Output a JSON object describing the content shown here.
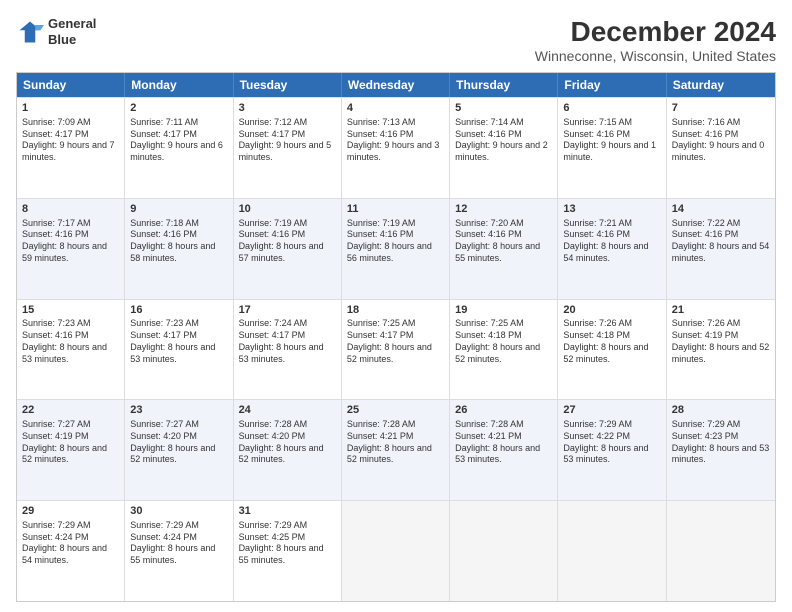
{
  "header": {
    "logo_line1": "General",
    "logo_line2": "Blue",
    "title": "December 2024",
    "subtitle": "Winneconne, Wisconsin, United States"
  },
  "days": [
    "Sunday",
    "Monday",
    "Tuesday",
    "Wednesday",
    "Thursday",
    "Friday",
    "Saturday"
  ],
  "rows": [
    [
      {
        "day": "1",
        "text": "Sunrise: 7:09 AM\nSunset: 4:17 PM\nDaylight: 9 hours and 7 minutes."
      },
      {
        "day": "2",
        "text": "Sunrise: 7:11 AM\nSunset: 4:17 PM\nDaylight: 9 hours and 6 minutes."
      },
      {
        "day": "3",
        "text": "Sunrise: 7:12 AM\nSunset: 4:17 PM\nDaylight: 9 hours and 5 minutes."
      },
      {
        "day": "4",
        "text": "Sunrise: 7:13 AM\nSunset: 4:16 PM\nDaylight: 9 hours and 3 minutes."
      },
      {
        "day": "5",
        "text": "Sunrise: 7:14 AM\nSunset: 4:16 PM\nDaylight: 9 hours and 2 minutes."
      },
      {
        "day": "6",
        "text": "Sunrise: 7:15 AM\nSunset: 4:16 PM\nDaylight: 9 hours and 1 minute."
      },
      {
        "day": "7",
        "text": "Sunrise: 7:16 AM\nSunset: 4:16 PM\nDaylight: 9 hours and 0 minutes."
      }
    ],
    [
      {
        "day": "8",
        "text": "Sunrise: 7:17 AM\nSunset: 4:16 PM\nDaylight: 8 hours and 59 minutes."
      },
      {
        "day": "9",
        "text": "Sunrise: 7:18 AM\nSunset: 4:16 PM\nDaylight: 8 hours and 58 minutes."
      },
      {
        "day": "10",
        "text": "Sunrise: 7:19 AM\nSunset: 4:16 PM\nDaylight: 8 hours and 57 minutes."
      },
      {
        "day": "11",
        "text": "Sunrise: 7:19 AM\nSunset: 4:16 PM\nDaylight: 8 hours and 56 minutes."
      },
      {
        "day": "12",
        "text": "Sunrise: 7:20 AM\nSunset: 4:16 PM\nDaylight: 8 hours and 55 minutes."
      },
      {
        "day": "13",
        "text": "Sunrise: 7:21 AM\nSunset: 4:16 PM\nDaylight: 8 hours and 54 minutes."
      },
      {
        "day": "14",
        "text": "Sunrise: 7:22 AM\nSunset: 4:16 PM\nDaylight: 8 hours and 54 minutes."
      }
    ],
    [
      {
        "day": "15",
        "text": "Sunrise: 7:23 AM\nSunset: 4:16 PM\nDaylight: 8 hours and 53 minutes."
      },
      {
        "day": "16",
        "text": "Sunrise: 7:23 AM\nSunset: 4:17 PM\nDaylight: 8 hours and 53 minutes."
      },
      {
        "day": "17",
        "text": "Sunrise: 7:24 AM\nSunset: 4:17 PM\nDaylight: 8 hours and 53 minutes."
      },
      {
        "day": "18",
        "text": "Sunrise: 7:25 AM\nSunset: 4:17 PM\nDaylight: 8 hours and 52 minutes."
      },
      {
        "day": "19",
        "text": "Sunrise: 7:25 AM\nSunset: 4:18 PM\nDaylight: 8 hours and 52 minutes."
      },
      {
        "day": "20",
        "text": "Sunrise: 7:26 AM\nSunset: 4:18 PM\nDaylight: 8 hours and 52 minutes."
      },
      {
        "day": "21",
        "text": "Sunrise: 7:26 AM\nSunset: 4:19 PM\nDaylight: 8 hours and 52 minutes."
      }
    ],
    [
      {
        "day": "22",
        "text": "Sunrise: 7:27 AM\nSunset: 4:19 PM\nDaylight: 8 hours and 52 minutes."
      },
      {
        "day": "23",
        "text": "Sunrise: 7:27 AM\nSunset: 4:20 PM\nDaylight: 8 hours and 52 minutes."
      },
      {
        "day": "24",
        "text": "Sunrise: 7:28 AM\nSunset: 4:20 PM\nDaylight: 8 hours and 52 minutes."
      },
      {
        "day": "25",
        "text": "Sunrise: 7:28 AM\nSunset: 4:21 PM\nDaylight: 8 hours and 52 minutes."
      },
      {
        "day": "26",
        "text": "Sunrise: 7:28 AM\nSunset: 4:21 PM\nDaylight: 8 hours and 53 minutes."
      },
      {
        "day": "27",
        "text": "Sunrise: 7:29 AM\nSunset: 4:22 PM\nDaylight: 8 hours and 53 minutes."
      },
      {
        "day": "28",
        "text": "Sunrise: 7:29 AM\nSunset: 4:23 PM\nDaylight: 8 hours and 53 minutes."
      }
    ],
    [
      {
        "day": "29",
        "text": "Sunrise: 7:29 AM\nSunset: 4:24 PM\nDaylight: 8 hours and 54 minutes."
      },
      {
        "day": "30",
        "text": "Sunrise: 7:29 AM\nSunset: 4:24 PM\nDaylight: 8 hours and 55 minutes."
      },
      {
        "day": "31",
        "text": "Sunrise: 7:29 AM\nSunset: 4:25 PM\nDaylight: 8 hours and 55 minutes."
      },
      {
        "day": "",
        "text": ""
      },
      {
        "day": "",
        "text": ""
      },
      {
        "day": "",
        "text": ""
      },
      {
        "day": "",
        "text": ""
      }
    ]
  ]
}
